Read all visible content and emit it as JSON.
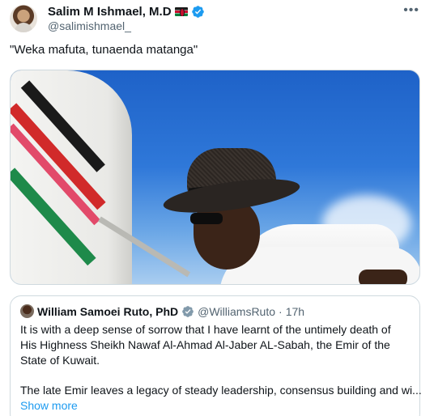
{
  "author": {
    "name": "Salim M Ishmael, M.D",
    "handle": "@salimishmael_",
    "flag": "kenya-flag",
    "verified_color": "#1d9bf0"
  },
  "tweet": {
    "text": "\"Weka mafuta, tunaenda matanga\""
  },
  "quoted_tweet": {
    "name": "William Samoei Ruto, PhD",
    "handle": "@WilliamsRuto",
    "separator": "·",
    "time": "17h",
    "paragraph1": "It is with a deep sense of sorrow that I have learnt of the untimely death of His Highness Sheikh Nawaf Al-Ahmad Al-Jaber AL-Sabah, the Emir of the State of Kuwait.",
    "paragraph2": "The late Emir leaves a legacy of steady leadership, consensus building and wi...",
    "show_more": "Show more"
  },
  "colors": {
    "text": "#0f1419",
    "secondary": "#536471",
    "link": "#1d9bf0",
    "border": "#cfd9de"
  }
}
